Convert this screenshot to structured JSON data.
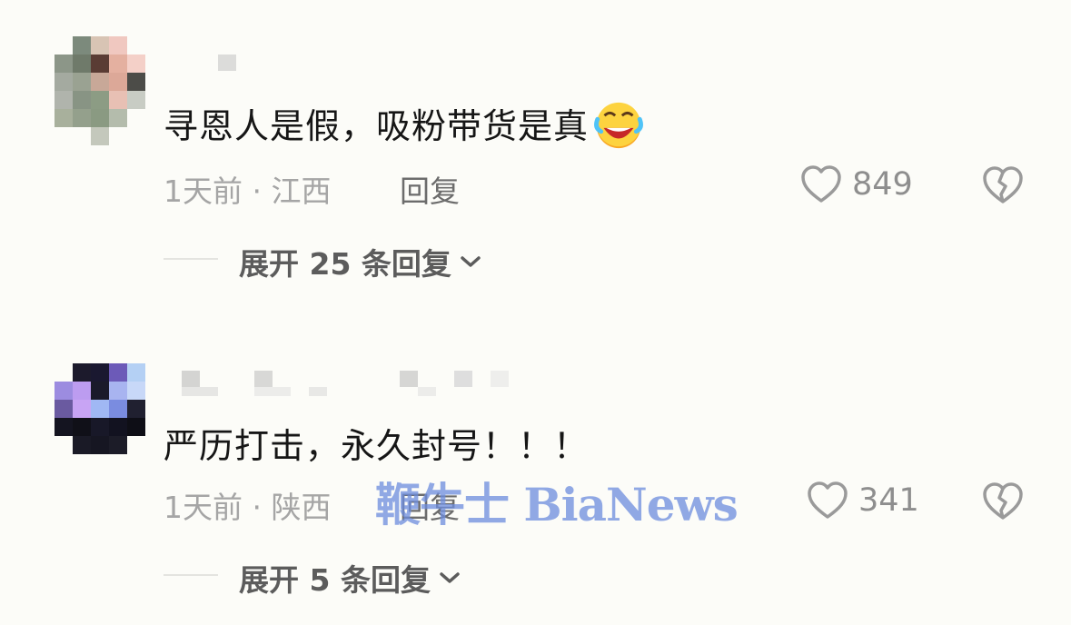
{
  "comments": [
    {
      "text": "寻恩人是假，吸粉带货是真",
      "emoji": "rolling-on-floor-laughing-emoji",
      "time": "1天前",
      "location": "江西",
      "reply_label": "回复",
      "likes": "849",
      "expand_label": "展开 25 条回复"
    },
    {
      "text": "严历打击，永久封号！！！",
      "time": "1天前",
      "location": "陕西",
      "reply_label": "回复",
      "likes": "341",
      "expand_label": "展开 5 条回复"
    }
  ],
  "meta_separator": "·",
  "watermark": "鞭牛士 BiaNews",
  "colors": {
    "background": "#fcfcf8",
    "text": "#161616",
    "meta": "#a5a5a5",
    "icon": "#9a9a9a",
    "watermark": "#6c8cde"
  }
}
